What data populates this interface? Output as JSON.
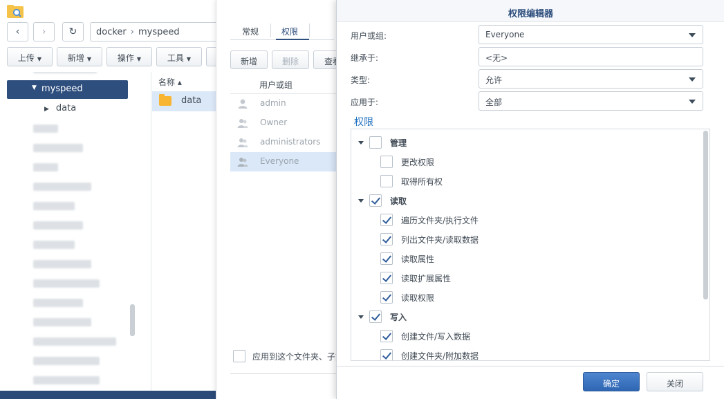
{
  "file_station": {
    "path": [
      "docker",
      "myspeed"
    ],
    "toolbar": {
      "upload": "上传",
      "create": "新增",
      "action": "操作",
      "tools": "工具"
    },
    "tree": {
      "selected": "myspeed",
      "child": "data"
    },
    "list": {
      "column_name": "名称 ▴",
      "items": [
        "data"
      ]
    }
  },
  "properties": {
    "tabs": [
      "常规",
      "权限"
    ],
    "buttons": {
      "create": "新增",
      "delete": "删除",
      "view": "查看"
    },
    "column_user": "用户或组",
    "users": [
      "admin",
      "Owner",
      "administrators",
      "Everyone"
    ],
    "apply_label": "应用到这个文件夹、子文件夹"
  },
  "permission_editor": {
    "title": "权限编辑器",
    "fields": {
      "user_label": "用户或组:",
      "user_value": "Everyone",
      "inherit_label": "继承于:",
      "inherit_value": "<无>",
      "type_label": "类型:",
      "type_value": "允许",
      "apply_label": "应用于:",
      "apply_value": "全部"
    },
    "section_title": "权限",
    "groups": [
      {
        "name": "管理",
        "checked": false,
        "items": [
          {
            "label": "更改权限",
            "checked": false
          },
          {
            "label": "取得所有权",
            "checked": false
          }
        ]
      },
      {
        "name": "读取",
        "checked": true,
        "items": [
          {
            "label": "遍历文件夹/执行文件",
            "checked": true
          },
          {
            "label": "列出文件夹/读取数据",
            "checked": true
          },
          {
            "label": "读取属性",
            "checked": true
          },
          {
            "label": "读取扩展属性",
            "checked": true
          },
          {
            "label": "读取权限",
            "checked": true
          }
        ]
      },
      {
        "name": "写入",
        "checked": true,
        "items": [
          {
            "label": "创建文件/写入数据",
            "checked": true
          },
          {
            "label": "创建文件夹/附加数据",
            "checked": true
          }
        ]
      }
    ],
    "ok_label": "确定",
    "close_label": "关闭"
  }
}
